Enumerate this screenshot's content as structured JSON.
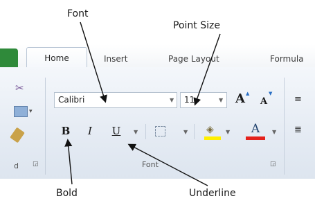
{
  "callouts": {
    "font": "Font",
    "point_size": "Point Size",
    "bold": "Bold",
    "underline": "Underline"
  },
  "tabs": {
    "home": "Home",
    "insert": "Insert",
    "page_layout": "Page Layout",
    "formulas": "Formula"
  },
  "font_group": {
    "font_name": "Calibri",
    "font_size": "11",
    "grow_font": "A",
    "shrink_font": "A",
    "bold": "B",
    "italic": "I",
    "underline": "U",
    "font_color": "A",
    "label": "Font"
  },
  "clipboard": {
    "label": "d"
  },
  "colors": {
    "highlight_yellow": "#ffef00",
    "font_red": "#e4211c",
    "file_tab_green": "#2f8a3a"
  }
}
